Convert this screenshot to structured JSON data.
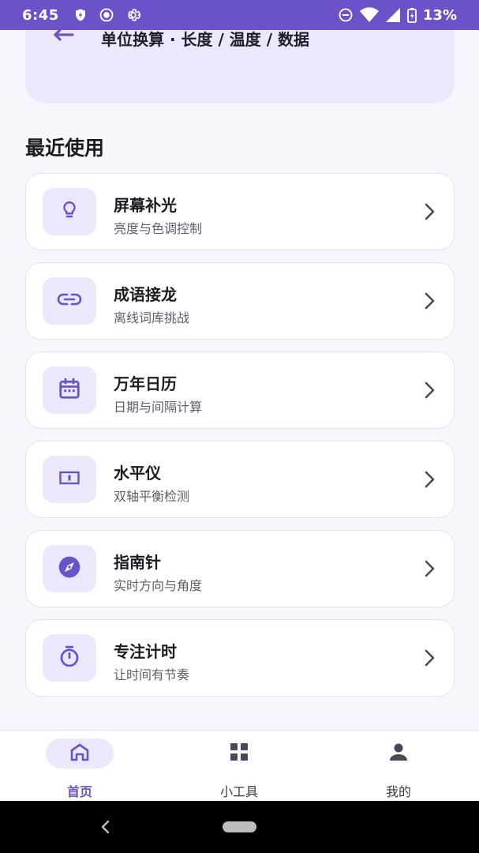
{
  "status_bar": {
    "time": "6:45",
    "battery": "13%",
    "icons": [
      "shield-icon",
      "radio-icon",
      "gear-icon",
      "do-not-disturb-icon",
      "wifi-icon",
      "signal-icon",
      "battery-charging-icon"
    ]
  },
  "top_card": {
    "subtitle": "单位换算 · 长度 / 温度 / 数据",
    "icon": "swap-arrows-icon"
  },
  "section": {
    "title": "最近使用"
  },
  "tools": [
    {
      "title": "屏幕补光",
      "subtitle": "亮度与色调控制",
      "icon": "lightbulb-icon"
    },
    {
      "title": "成语接龙",
      "subtitle": "离线词库挑战",
      "icon": "link-icon"
    },
    {
      "title": "万年日历",
      "subtitle": "日期与间隔计算",
      "icon": "calendar-icon"
    },
    {
      "title": "水平仪",
      "subtitle": "双轴平衡检测",
      "icon": "level-icon"
    },
    {
      "title": "指南针",
      "subtitle": "实时方向与角度",
      "icon": "compass-icon"
    },
    {
      "title": "专注计时",
      "subtitle": "让时间有节奏",
      "icon": "timer-icon"
    }
  ],
  "bottom_nav": {
    "items": [
      {
        "label": "首页",
        "icon": "home-icon",
        "active": true
      },
      {
        "label": "小工具",
        "icon": "grid-icon",
        "active": false
      },
      {
        "label": "我的",
        "icon": "person-icon",
        "active": false
      }
    ]
  },
  "colors": {
    "accent": "#6b52c8",
    "accent_light": "#ece8fb",
    "background": "#f7f6fc",
    "card": "#ffffff"
  }
}
